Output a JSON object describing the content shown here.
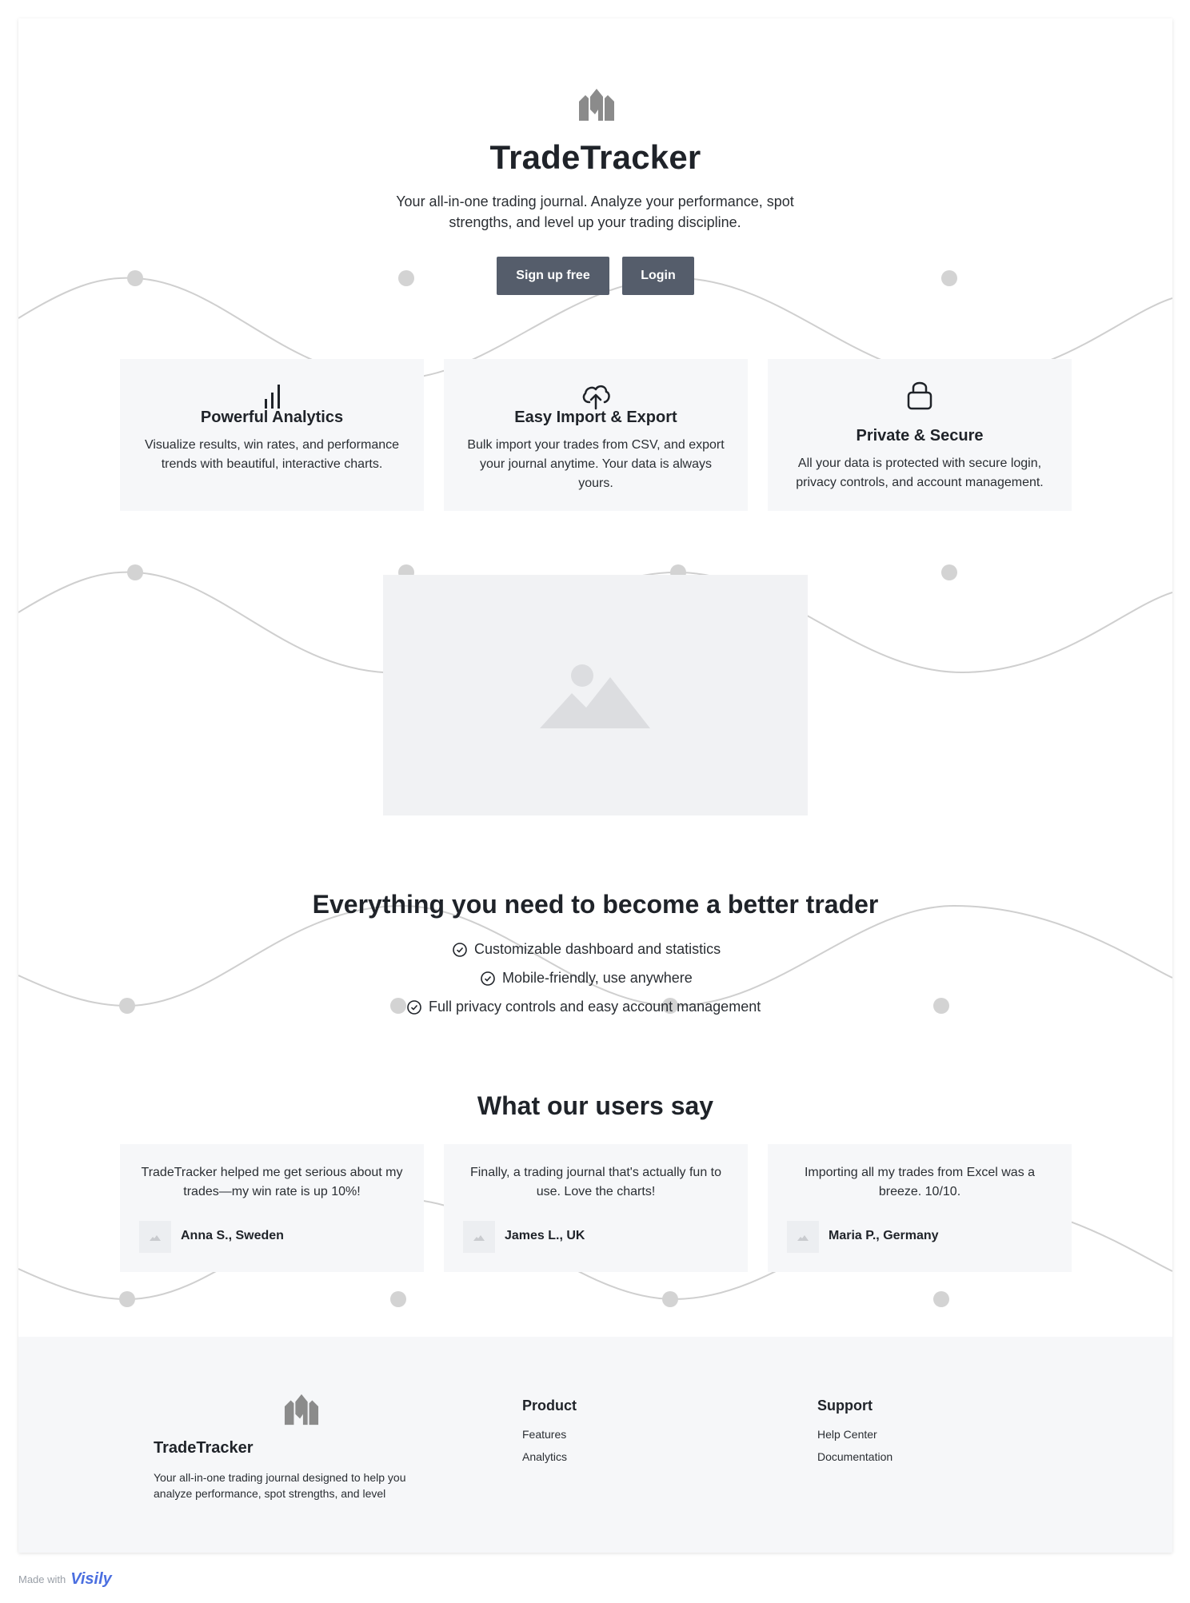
{
  "hero": {
    "brand": "TradeTracker",
    "subtitle": "Your all-in-one trading journal. Analyze your performance, spot strengths, and level up your trading discipline.",
    "signup_label": "Sign up free",
    "login_label": "Login"
  },
  "features": [
    {
      "icon": "bar-chart-icon",
      "title": "Powerful Analytics",
      "desc": "Visualize results, win rates, and performance trends with beautiful, interactive charts."
    },
    {
      "icon": "cloud-upload-icon",
      "title": "Easy Import & Export",
      "desc": "Bulk import your trades from CSV, and export your journal anytime. Your data is always yours."
    },
    {
      "icon": "lock-icon",
      "title": "Private & Secure",
      "desc": "All your data is protected with secure login, privacy controls, and account management."
    }
  ],
  "benefits": {
    "title": "Everything you need to become a better trader",
    "items": [
      "Customizable dashboard and statistics",
      "Mobile-friendly, use anywhere",
      "Full privacy controls and easy account management"
    ]
  },
  "testimonials": {
    "title": "What our users say",
    "items": [
      {
        "quote": "TradeTracker helped me get serious about my trades—my win rate is up 10%!",
        "name": "Anna S., Sweden"
      },
      {
        "quote": "Finally, a trading journal that's actually fun to use. Love the charts!",
        "name": "James L., UK"
      },
      {
        "quote": "Importing all my trades from Excel was a breeze. 10/10.",
        "name": "Maria P., Germany"
      }
    ]
  },
  "footer": {
    "brand": "TradeTracker",
    "desc": "Your all-in-one trading journal designed to help you analyze performance, spot strengths, and level",
    "product_title": "Product",
    "product_links": [
      "Features",
      "Analytics"
    ],
    "support_title": "Support",
    "support_links": [
      "Help Center",
      "Documentation"
    ]
  },
  "badge": {
    "made_with": "Made with",
    "brand": "Visily"
  },
  "colors": {
    "button_bg": "#555d6b",
    "card_bg": "#f6f7f9",
    "footer_bg": "#f6f7f9",
    "wave": "#cfcfcf",
    "visily_brand": "#4b6fe0"
  }
}
